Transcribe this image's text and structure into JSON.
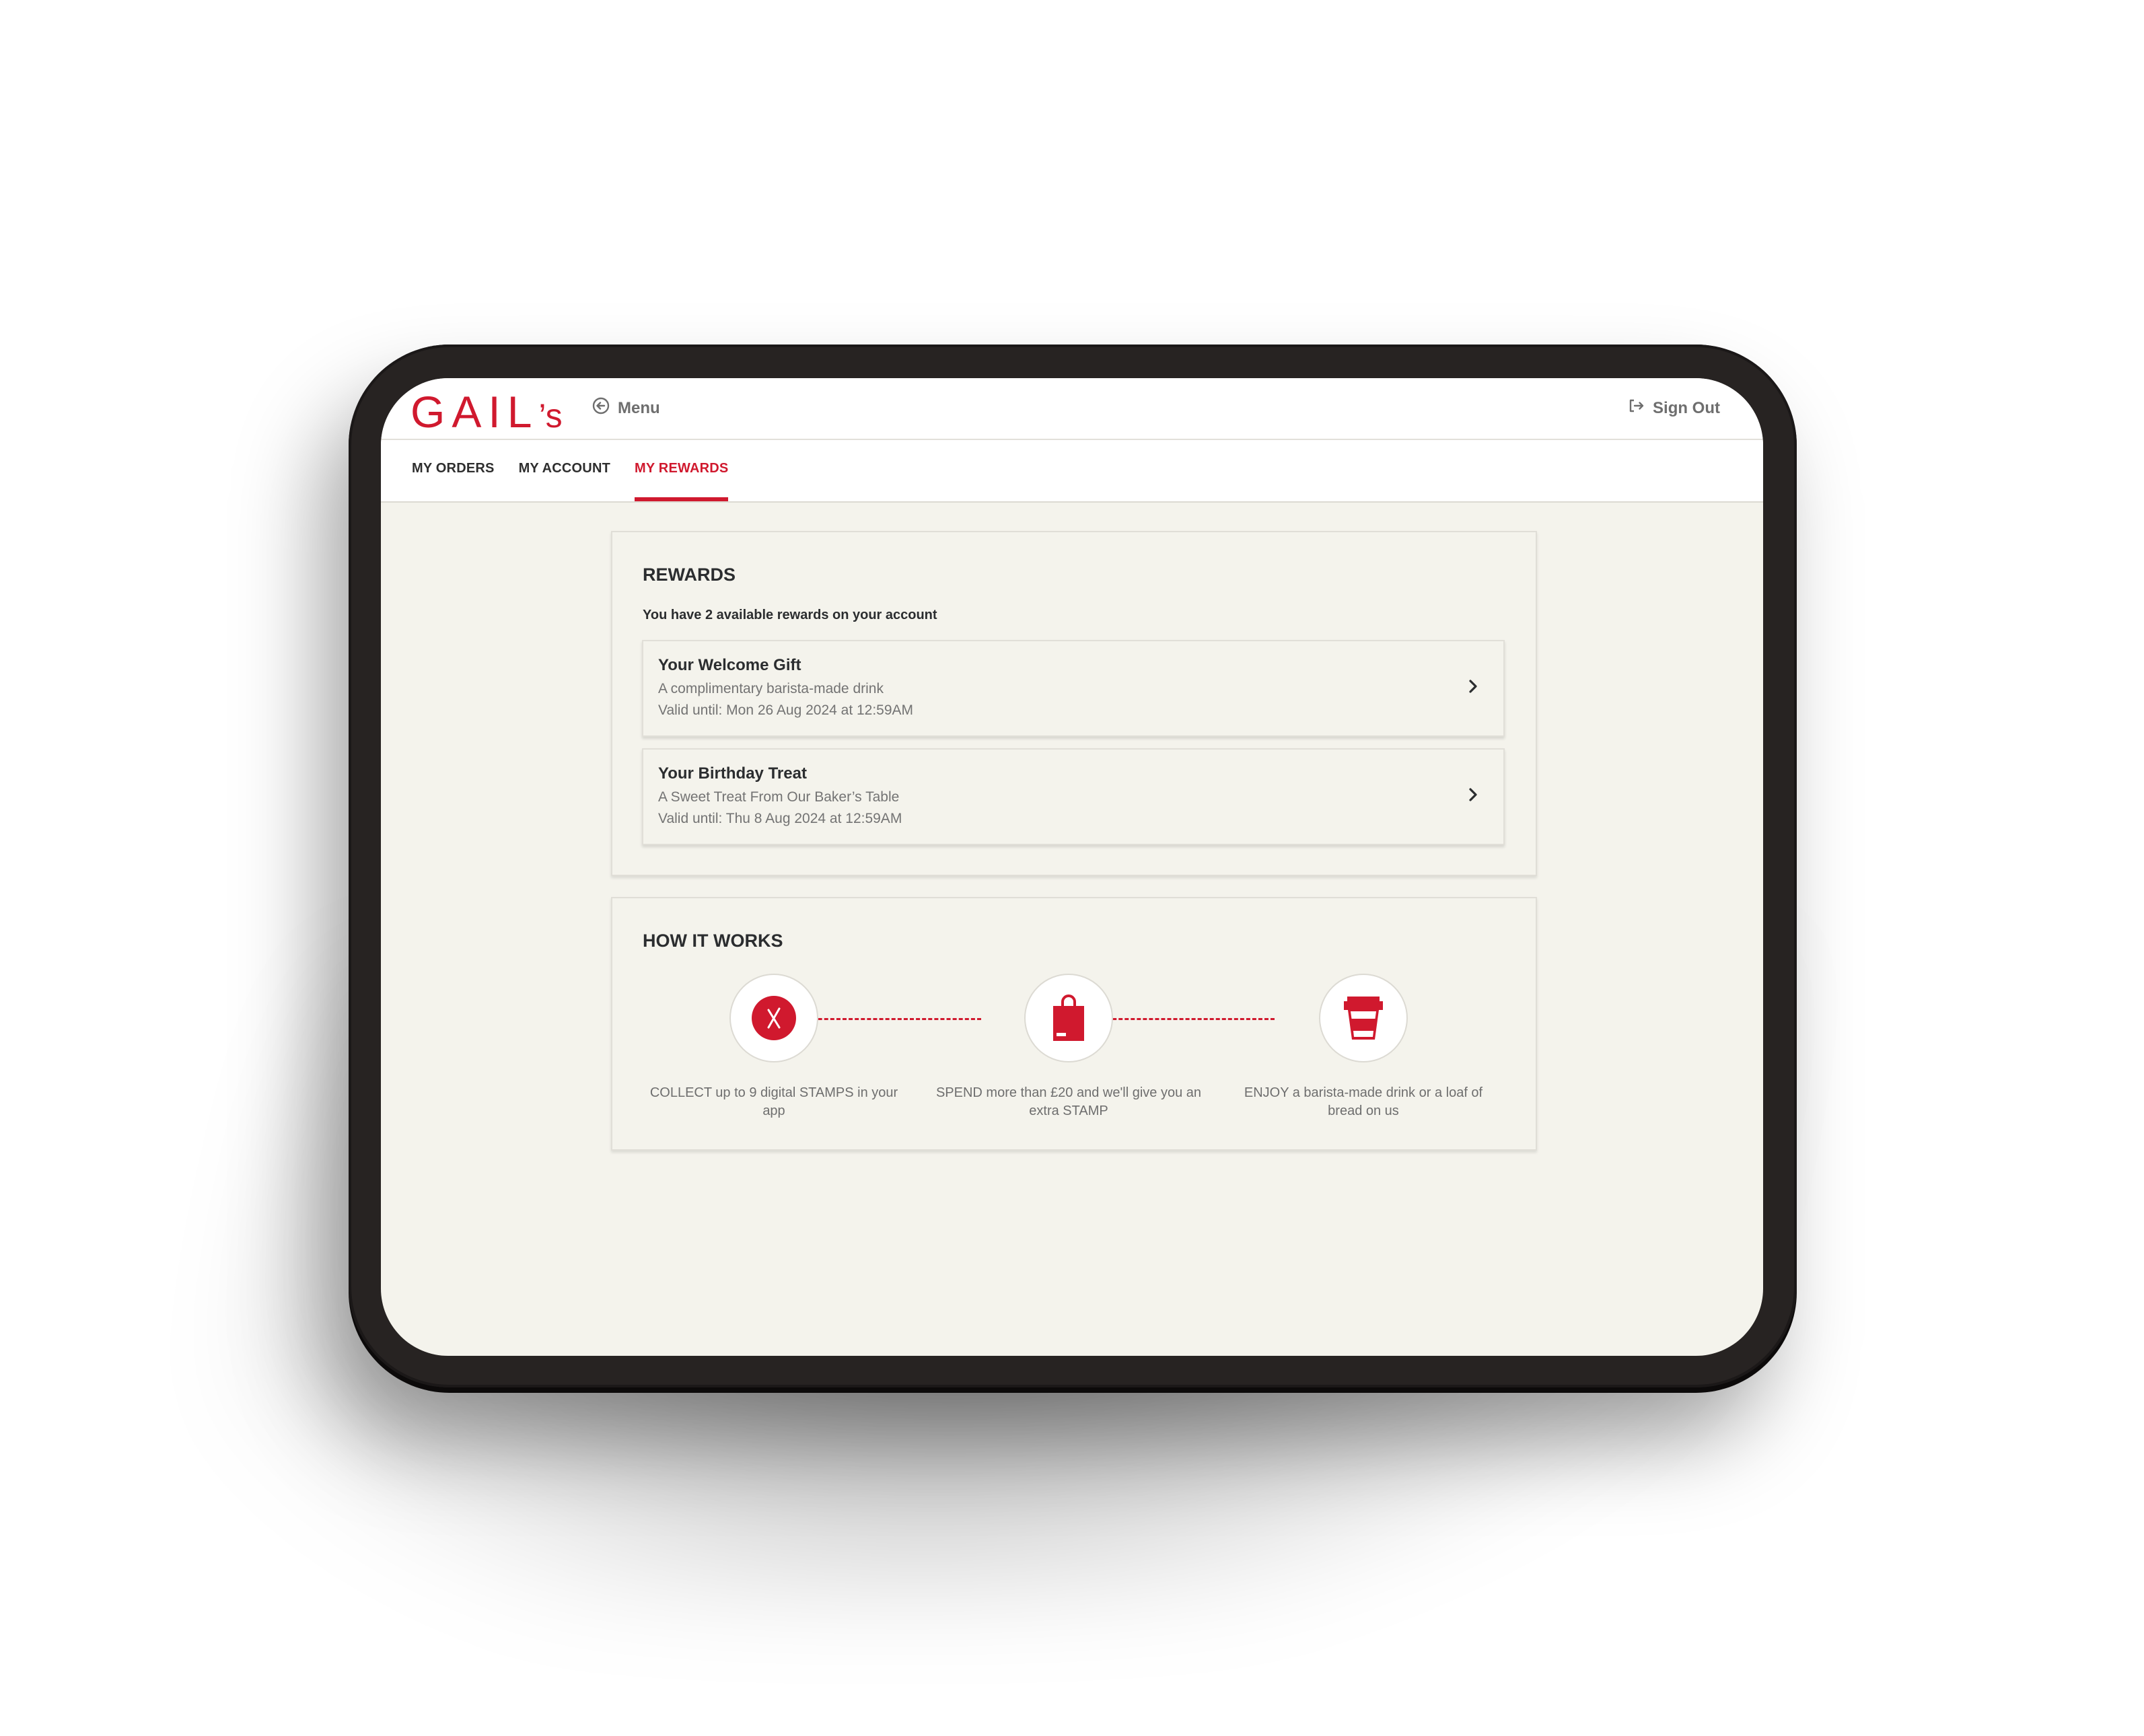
{
  "app": {
    "brand": "GAIL",
    "brand_suffix": "’s",
    "brand_color": "#d0192e"
  },
  "header": {
    "menu_label": "Menu",
    "menu_icon": "circle-arrow-left-icon",
    "signout_label": "Sign Out",
    "signout_icon": "sign-out-icon"
  },
  "tabs": [
    {
      "label": "MY ORDERS",
      "active": false
    },
    {
      "label": "MY ACCOUNT",
      "active": false
    },
    {
      "label": "MY REWARDS",
      "active": true
    }
  ],
  "rewards": {
    "title": "REWARDS",
    "summary": "You have 2 available rewards on your account",
    "available_count": 2,
    "items": [
      {
        "title": "Your Welcome Gift",
        "description": "A complimentary barista-made drink",
        "valid_until": "Valid until: Mon 26 Aug 2024 at 12:59AM",
        "icon": "chevron-right-icon"
      },
      {
        "title": "Your Birthday Treat",
        "description": "A Sweet Treat From Our Baker’s Table",
        "valid_until": "Valid until: Thu 8 Aug 2024 at 12:59AM",
        "icon": "chevron-right-icon"
      }
    ]
  },
  "how_it_works": {
    "title": "HOW IT WORKS",
    "steps": [
      {
        "icon": "stamp-icon",
        "text": "COLLECT up to 9 digital STAMPS in your app"
      },
      {
        "icon": "shopping-bag-icon",
        "text": "SPEND more than £20 and we'll give you an extra STAMP"
      },
      {
        "icon": "coffee-cup-icon",
        "text": "ENJOY a barista-made drink or a loaf of bread on us"
      }
    ]
  }
}
